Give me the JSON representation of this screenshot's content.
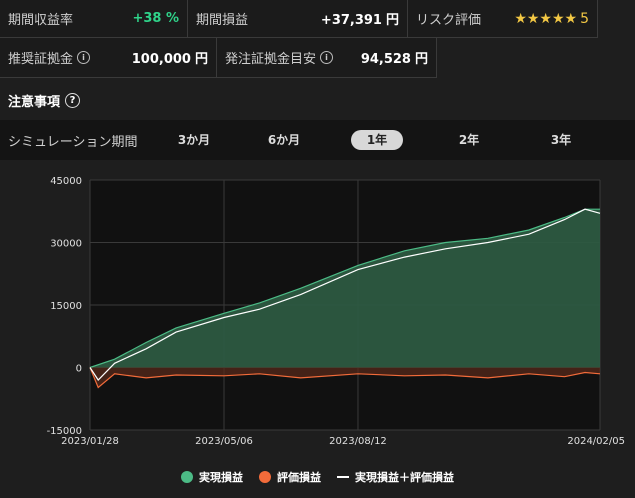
{
  "stats": {
    "period_return_label": "期間収益率",
    "period_return_value": "+38 %",
    "period_pnl_label": "期間損益",
    "period_pnl_value": "+37,391",
    "period_pnl_unit": "円",
    "risk_label": "リスク評価",
    "risk_stars": "★★★★★",
    "risk_value": "5",
    "recommended_margin_label": "推奨証拠金",
    "recommended_margin_value": "100,000",
    "recommended_margin_unit": "円",
    "order_margin_label": "発注証拠金目安",
    "order_margin_value": "94,528",
    "order_margin_unit": "円"
  },
  "notice": {
    "label": "注意事項"
  },
  "period": {
    "label": "シミュレーション期間",
    "tabs": [
      "3か月",
      "6か月",
      "1年",
      "2年",
      "3年"
    ],
    "selected": "1年"
  },
  "legend": {
    "realized": "実現損益",
    "unrealized": "評価損益",
    "total": "実現損益＋評価損益"
  },
  "colors": {
    "realized": "#4cbb86",
    "realized_fill": "#2d5a41",
    "unrealized": "#f26b3a",
    "total": "#ffffff",
    "accent_positive": "#2fd38a",
    "star": "#f2c744"
  },
  "chart_data": {
    "type": "area",
    "ylim": [
      -15000,
      45000
    ],
    "yticks": [
      -15000,
      0,
      15000,
      30000,
      45000
    ],
    "xticks": [
      "2023/01/28",
      "2023/05/06",
      "2023/08/12",
      "2024/02/05"
    ],
    "x_range": [
      "2023/01/28",
      "2024/02/05"
    ],
    "grid": true,
    "series": [
      {
        "name": "実現損益",
        "x": [
          "2023/01/28",
          "2023/02/15",
          "2023/03/10",
          "2023/04/01",
          "2023/05/06",
          "2023/06/01",
          "2023/07/01",
          "2023/08/12",
          "2023/09/15",
          "2023/10/15",
          "2023/11/15",
          "2023/12/15",
          "2024/01/10",
          "2024/01/25",
          "2024/02/05"
        ],
        "values": [
          0,
          2000,
          6000,
          9500,
          13000,
          15500,
          19000,
          24500,
          28000,
          30000,
          31000,
          33000,
          36000,
          38000,
          38000
        ]
      },
      {
        "name": "評価損益",
        "x": [
          "2023/01/28",
          "2023/02/03",
          "2023/02/15",
          "2023/03/10",
          "2023/04/01",
          "2023/05/06",
          "2023/06/01",
          "2023/07/01",
          "2023/08/12",
          "2023/09/15",
          "2023/10/15",
          "2023/11/15",
          "2023/12/15",
          "2024/01/10",
          "2024/01/25",
          "2024/02/05"
        ],
        "values": [
          0,
          -4800,
          -1500,
          -2500,
          -1800,
          -2000,
          -1500,
          -2500,
          -1500,
          -2000,
          -1800,
          -2500,
          -1500,
          -2200,
          -1200,
          -1500
        ]
      },
      {
        "name": "実現損益＋評価損益",
        "x": [
          "2023/01/28",
          "2023/02/03",
          "2023/02/15",
          "2023/03/10",
          "2023/04/01",
          "2023/05/06",
          "2023/06/01",
          "2023/07/01",
          "2023/08/12",
          "2023/09/15",
          "2023/10/15",
          "2023/11/15",
          "2023/12/15",
          "2024/01/10",
          "2024/01/25",
          "2024/02/05"
        ],
        "values": [
          0,
          -3000,
          1000,
          4500,
          8500,
          12000,
          14000,
          17500,
          23500,
          26500,
          28500,
          30000,
          32000,
          35500,
          38000,
          37000
        ]
      }
    ]
  }
}
